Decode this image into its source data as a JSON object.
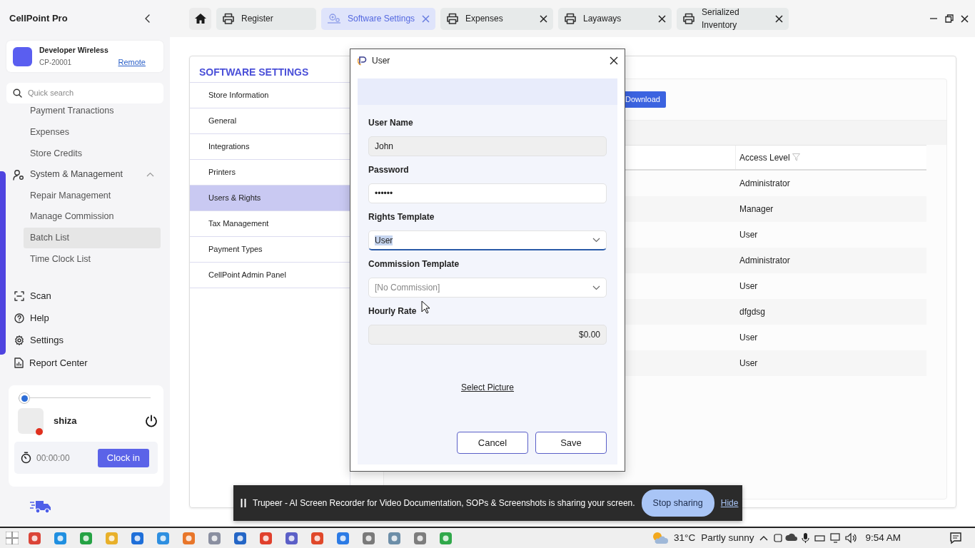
{
  "app": {
    "title": "CellPoint Pro"
  },
  "store": {
    "name": "Developer Wireless",
    "code": "CP-20001",
    "link": "Remote"
  },
  "search": {
    "placeholder": "Quick search"
  },
  "nav": [
    {
      "label": "Payment Tranactions",
      "kind": "link",
      "selected": false
    },
    {
      "label": "Expenses",
      "kind": "link",
      "selected": false
    },
    {
      "label": "Store Credits",
      "kind": "link",
      "selected": false
    },
    {
      "label": "System & Management",
      "kind": "group",
      "expanded": true
    },
    {
      "label": "Repair Management",
      "kind": "link",
      "selected": false
    },
    {
      "label": "Manage Commission",
      "kind": "link",
      "selected": false
    },
    {
      "label": "Batch List",
      "kind": "link",
      "selected": true
    },
    {
      "label": "Time Clock List",
      "kind": "link",
      "selected": false
    }
  ],
  "actions": [
    {
      "label": "Scan",
      "kind": "scan"
    },
    {
      "label": "Help",
      "kind": "help"
    },
    {
      "label": "Settings",
      "kind": "settings"
    },
    {
      "label": "Report Center",
      "kind": "report"
    }
  ],
  "user_card": {
    "level": 0,
    "name": "shiza",
    "timer": "00:00:00",
    "button": "Clock in"
  },
  "tabs": [
    {
      "label": "Register",
      "kind": "printer",
      "selected": false,
      "closable": false
    },
    {
      "label": "Software Settings",
      "kind": "settings",
      "selected": true,
      "closable": true
    },
    {
      "label": "Expenses",
      "kind": "printer",
      "selected": false,
      "closable": true
    },
    {
      "label": "Layaways",
      "kind": "printer",
      "selected": false,
      "closable": true
    },
    {
      "label": "Serialized Inventory",
      "kind": "printer",
      "selected": false,
      "closable": true
    }
  ],
  "settings": {
    "title": "SOFTWARE SETTINGS",
    "items": [
      {
        "label": "Store Information",
        "selected": false
      },
      {
        "label": "General",
        "selected": false
      },
      {
        "label": "Integrations",
        "selected": false
      },
      {
        "label": "Printers",
        "selected": false
      },
      {
        "label": "Users & Rights",
        "selected": true
      },
      {
        "label": "Tax Management",
        "selected": false
      },
      {
        "label": "Payment Types",
        "selected": false
      },
      {
        "label": "CellPoint Admin Panel",
        "selected": false
      }
    ]
  },
  "users": {
    "download": "Download",
    "columns": [
      "Access Level"
    ],
    "rows": [
      [
        "Administrator"
      ],
      [
        "Manager"
      ],
      [
        "User"
      ],
      [
        "Administrator"
      ],
      [
        "User"
      ],
      [
        "dfgdsg"
      ],
      [
        "User"
      ],
      [
        "User"
      ]
    ]
  },
  "dialog": {
    "title": "User",
    "fields": [
      {
        "label": "User Name",
        "value": "John",
        "kind": "text",
        "disabled": true,
        "focused": false
      },
      {
        "label": "Password",
        "value": "••••••",
        "kind": "text",
        "disabled": false,
        "focused": false
      },
      {
        "label": "Rights Template",
        "value": "User",
        "kind": "select",
        "disabled": false,
        "focused": true
      },
      {
        "label": "Commission Template",
        "placeholder": "[No Commission]",
        "kind": "select",
        "disabled": false,
        "focused": false
      },
      {
        "label": "Hourly Rate",
        "value": "$0.00",
        "kind": "money",
        "disabled": true,
        "focused": false
      }
    ],
    "link": "Select Picture",
    "buttons": [
      "Cancel",
      "Save"
    ]
  },
  "share_bar": {
    "message": "Trupeer - AI Screen Recorder for Video Documentation, SOPs & Screenshots is sharing your screen.",
    "button": "Stop sharing",
    "link": "Hide"
  },
  "taskbar": {
    "temperature": "31°C",
    "weather": "Partly sunny",
    "time": "9:54 AM"
  }
}
